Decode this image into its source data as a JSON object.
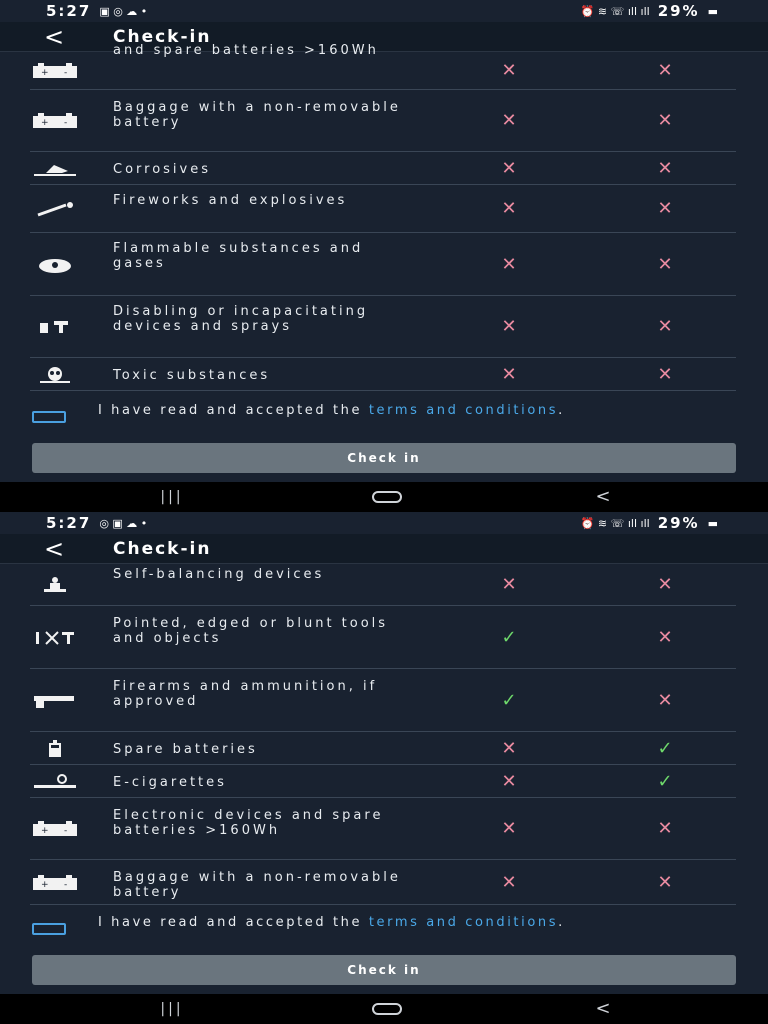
{
  "screens": [
    {
      "status": {
        "time": "5:27",
        "battery": "29%"
      },
      "title": "Check-in",
      "rows": [
        {
          "icon": "battery-pack-icon",
          "label": "and spare batteries >160Wh",
          "cabin": "not-allowed",
          "hold": "not-allowed"
        },
        {
          "icon": "battery-pack-icon",
          "label": "Baggage with a non-removable battery",
          "cabin": "not-allowed",
          "hold": "not-allowed"
        },
        {
          "icon": "corrosives-icon",
          "label": "Corrosives",
          "cabin": "not-allowed",
          "hold": "not-allowed"
        },
        {
          "icon": "fireworks-icon",
          "label": "Fireworks and explosives",
          "cabin": "not-allowed",
          "hold": "not-allowed"
        },
        {
          "icon": "flame-icon",
          "label": "Flammable substances and gases",
          "cabin": "not-allowed",
          "hold": "not-allowed"
        },
        {
          "icon": "spray-icon",
          "label": "Disabling or incapacitating devices and sprays",
          "cabin": "not-allowed",
          "hold": "not-allowed"
        },
        {
          "icon": "skull-icon",
          "label": "Toxic substances",
          "cabin": "not-allowed",
          "hold": "not-allowed"
        }
      ],
      "terms": {
        "text": "I have read and accepted the ",
        "link": "terms and conditions",
        "tail": "."
      },
      "button": "Check in"
    },
    {
      "status": {
        "time": "5:27",
        "battery": "29%"
      },
      "title": "Check-in",
      "rows": [
        {
          "icon": "hoverboard-icon",
          "label": "Self-balancing devices",
          "cabin": "not-allowed",
          "hold": "not-allowed"
        },
        {
          "icon": "tools-icon",
          "label": "Pointed, edged or blunt tools and objects",
          "cabin": "allowed",
          "hold": "not-allowed"
        },
        {
          "icon": "gun-icon",
          "label": "Firearms and ammunition, if approved",
          "cabin": "allowed",
          "hold": "not-allowed"
        },
        {
          "icon": "battery-icon",
          "label": "Spare batteries",
          "cabin": "not-allowed",
          "hold": "allowed"
        },
        {
          "icon": "ecig-icon",
          "label": "E-cigarettes",
          "cabin": "not-allowed",
          "hold": "allowed"
        },
        {
          "icon": "battery-pack-icon",
          "label": "Electronic devices and spare batteries >160Wh",
          "cabin": "not-allowed",
          "hold": "not-allowed"
        },
        {
          "icon": "battery-pack-icon",
          "label": "Baggage with a non-removable battery",
          "cabin": "not-allowed",
          "hold": "not-allowed"
        }
      ],
      "terms": {
        "text": "I have read and accepted the ",
        "link": "terms and conditions",
        "tail": "."
      },
      "button": "Check in"
    }
  ],
  "colors": {
    "background": "#192230",
    "appbar": "#121b26",
    "cross": "#e88aa0",
    "check": "#6ed86b",
    "link": "#4aa8e8",
    "button": "#6a757e"
  },
  "icons": {
    "not-allowed": "✕",
    "allowed": "✓"
  }
}
